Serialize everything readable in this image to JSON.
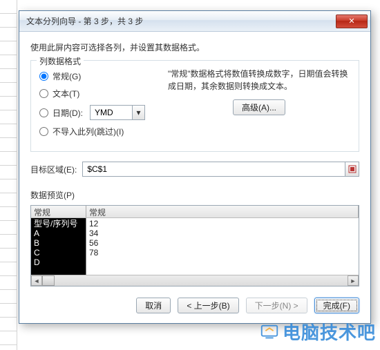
{
  "window": {
    "title": "文本分列向导 - 第 3 步，共 3 步",
    "close": "✕"
  },
  "instruction": "使用此屏内容可选择各列，并设置其数据格式。",
  "format_group": {
    "legend": "列数据格式",
    "general": "常规(G)",
    "text": "文本(T)",
    "date": "日期(D):",
    "date_value": "YMD",
    "skip": "不导入此列(跳过)(I)",
    "desc": "\"常规\"数据格式将数值转换成数字，日期值会转换成日期，其余数据则转换成文本。",
    "advanced": "高级(A)..."
  },
  "destination": {
    "label": "目标区域(E):",
    "value": "$C$1"
  },
  "preview": {
    "label": "数据预览(P)",
    "col1_header": "常规",
    "col2_header": "常规",
    "rows": [
      {
        "c1": "型号/序列号",
        "c2": ""
      },
      {
        "c1": "A",
        "c2": "12"
      },
      {
        "c1": "B",
        "c2": "34"
      },
      {
        "c1": "C",
        "c2": "56"
      },
      {
        "c1": "D",
        "c2": "78"
      }
    ]
  },
  "footer": {
    "cancel": "取消",
    "back": "< 上一步(B)",
    "next": "下一步(N) >",
    "finish": "完成(F)"
  },
  "chart_data": {
    "type": "table",
    "columns": [
      "常规",
      "常规"
    ],
    "rows": [
      [
        "型号/序列号",
        ""
      ],
      [
        "A",
        "12"
      ],
      [
        "B",
        "34"
      ],
      [
        "C",
        "56"
      ],
      [
        "D",
        "78"
      ]
    ]
  },
  "watermark": "电脑技术吧"
}
